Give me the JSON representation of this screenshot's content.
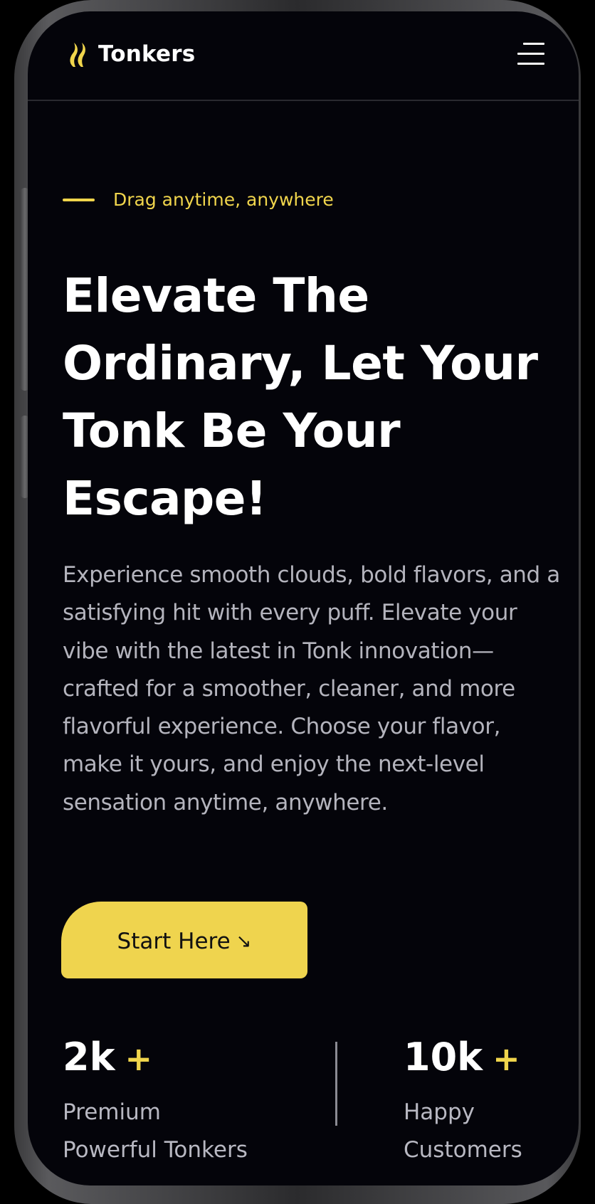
{
  "header": {
    "brand": "Tonkers",
    "logo_icon": "flame-icon",
    "menu_icon": "hamburger-menu-icon"
  },
  "hero": {
    "eyebrow": "Drag anytime, anywhere",
    "headline": "Elevate The Ordinary, Let Your Tonk Be Your Escape!",
    "description": "Experience smooth clouds, bold flavors, and a satisfying hit with every puff. Elevate your vibe with the latest in Tonk innovation—crafted for a smoother, cleaner, and more flavorful experience. Choose your flavor, make it yours, and enjoy the next-level sensation anytime, anywhere.",
    "cta_label": "Start Here",
    "cta_icon": "arrow-down-right-icon",
    "cta_arrow": "↘"
  },
  "stats": [
    {
      "value": "2k",
      "plus": "+",
      "label_line1": "Premium",
      "label_line2": "Powerful Tonkers"
    },
    {
      "value": "10k",
      "plus": "+",
      "label_line1": "Happy",
      "label_line2": "Customers"
    }
  ],
  "colors": {
    "accent": "#f0d54c",
    "background": "#04040a",
    "text": "#ffffff",
    "muted_text": "#b4b4bd"
  }
}
